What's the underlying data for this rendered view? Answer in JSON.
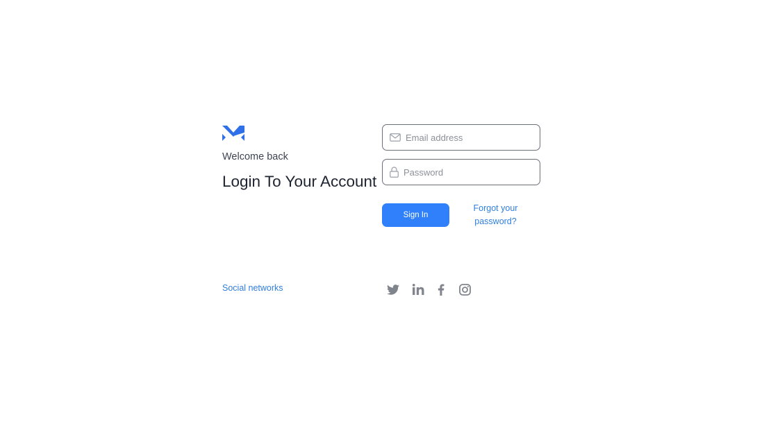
{
  "brand": {
    "logo_icon": "m-logo-icon",
    "logo_color": "#2f6fe8"
  },
  "header": {
    "welcome": "Welcome back",
    "title": "Login To Your Account"
  },
  "form": {
    "email": {
      "placeholder": "Email address",
      "value": "",
      "icon": "envelope-icon"
    },
    "password": {
      "placeholder": "Password",
      "value": "",
      "icon": "lock-icon"
    },
    "sign_in_label": "Sign In",
    "forgot_label": "Forgot your password?"
  },
  "social": {
    "label": "Social networks",
    "icons": [
      "twitter-icon",
      "linkedin-icon",
      "facebook-icon",
      "instagram-icon"
    ]
  },
  "colors": {
    "accent": "#2f80fa",
    "link": "#2f7ee0",
    "icon_gray": "#80848c",
    "text": "#1f2431"
  }
}
